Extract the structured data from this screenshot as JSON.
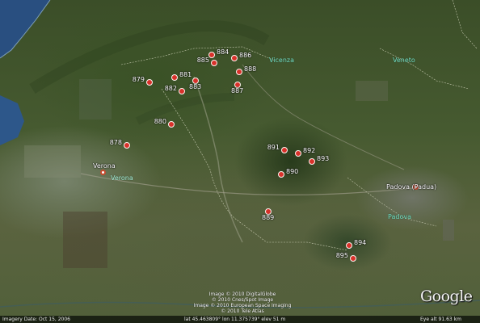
{
  "markers": [
    {
      "label": "884",
      "side": "right"
    },
    {
      "label": "885",
      "side": "left"
    },
    {
      "label": "886",
      "side": "right"
    },
    {
      "label": "888",
      "side": "right"
    },
    {
      "label": "887",
      "side": "right"
    },
    {
      "label": "881",
      "side": "right"
    },
    {
      "label": "879",
      "side": "left"
    },
    {
      "label": "883",
      "side": "right"
    },
    {
      "label": "882",
      "side": "left"
    },
    {
      "label": "880",
      "side": "left"
    },
    {
      "label": "878",
      "side": "left"
    },
    {
      "label": "891",
      "side": "left"
    },
    {
      "label": "892",
      "side": "right"
    },
    {
      "label": "893",
      "side": "right"
    },
    {
      "label": "890",
      "side": "right"
    },
    {
      "label": "889",
      "side": "right"
    },
    {
      "label": "894",
      "side": "right"
    },
    {
      "label": "895",
      "side": "left"
    }
  ],
  "cities": {
    "verona": "Verona",
    "padova": "Padova (Padua)"
  },
  "region_labels": {
    "verona": "Verona",
    "vicenza": "Vicenza",
    "veneto": "Veneto",
    "padova": "Padova"
  },
  "copyright_lines": [
    "Image © 2010 DigitalGlobe",
    "© 2010 Cnes/Spot Image",
    "Image © 2010 European Space Imaging",
    "© 2010 Tele Atlas"
  ],
  "logo": "Google",
  "status_bar": {
    "imagery_date": "Imagery Date: Oct 15, 2006",
    "coordinates": "lat 45.463809°  lon 11.375739°  elev 51 m",
    "eye_alt": "Eye alt 91.63 km"
  },
  "colors": {
    "marker": "#d8312a",
    "region_label": "#74e0c5",
    "water": "#284f84"
  }
}
